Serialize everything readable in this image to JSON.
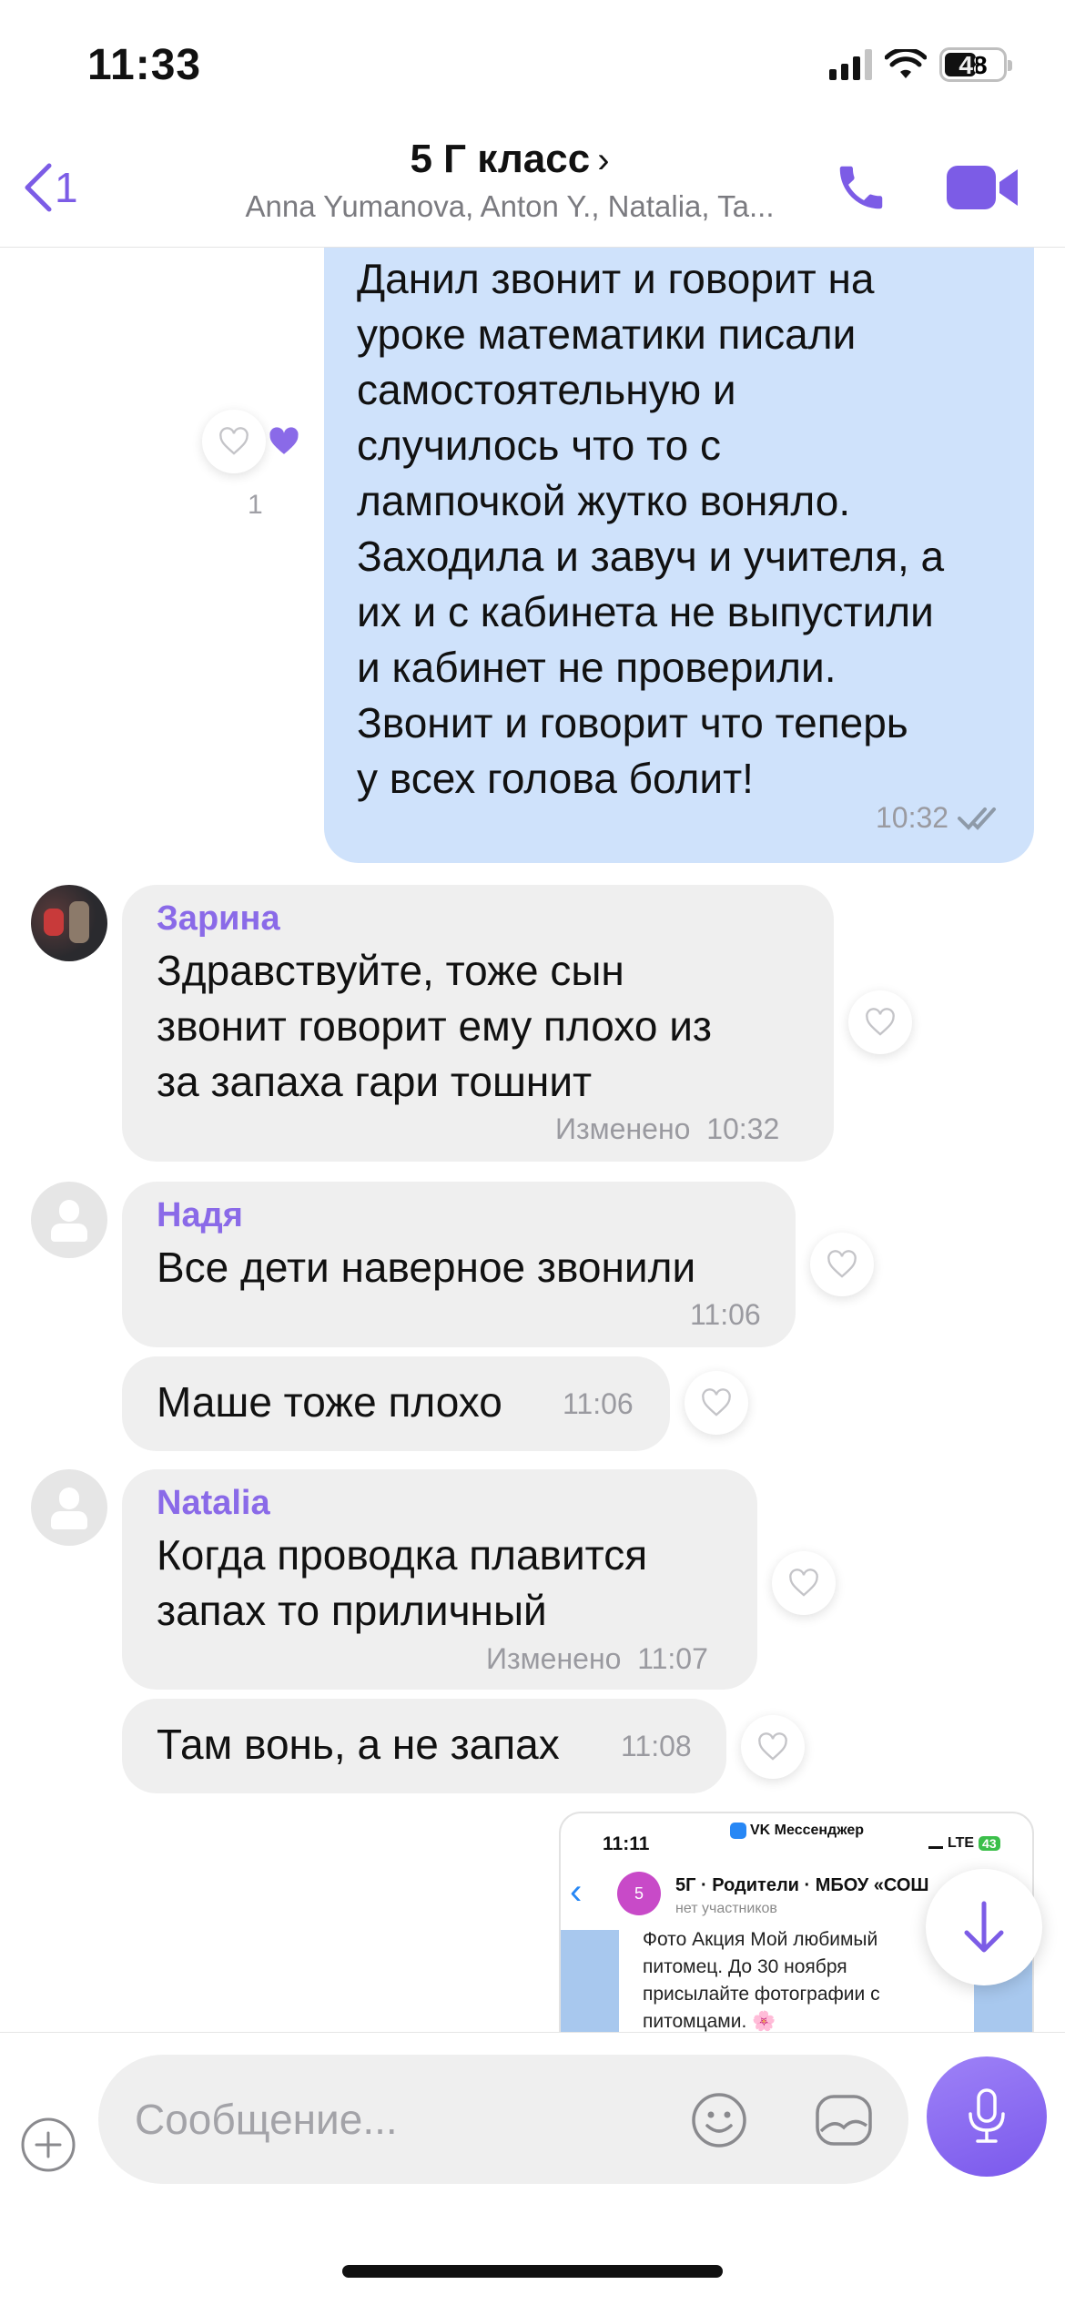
{
  "status_bar": {
    "time": "11:33",
    "battery": "48"
  },
  "header": {
    "back_count": "1",
    "title": "5 Г класс",
    "title_chevron": "›",
    "subtitle": "Anna Yumanova, Anton Y., Natalia, Ta..."
  },
  "messages": {
    "m1": {
      "text_lines": [
        "Данил звонит и говорит на",
        "уроке математики писали",
        "самостоятельную и",
        "случилось что то с",
        "лампочкой жутко воняло.",
        "Заходила и завуч и учителя, а",
        "их и с кабинета не выпустили",
        "и кабинет не проверили.",
        "Звонит  и говорит что теперь",
        "у всех голова болит!"
      ],
      "time": "10:32",
      "like_count": "1"
    },
    "m2": {
      "sender": "Зарина",
      "text_lines": [
        "Здравствуйте, тоже сын",
        "звонит говорит ему плохо из",
        "за запаха гари тошнит"
      ],
      "edited": "Изменено",
      "time": "10:32"
    },
    "m3": {
      "sender": "Надя",
      "text": "Все дети наверное звонили",
      "time": "11:06"
    },
    "m4": {
      "text": "Маше тоже плохо",
      "time": "11:06"
    },
    "m5": {
      "sender": "Natalia",
      "text_lines": [
        "Когда проводка плавится",
        "запах то приличный"
      ],
      "edited": "Изменено",
      "time": "11:07"
    },
    "m6": {
      "text": "Там вонь, а не запах",
      "time": "11:08"
    },
    "screenshot": {
      "time": "11:11",
      "app": "VK Мессенджер",
      "network": "LTE",
      "battery": "43",
      "chat_title": "5Г · Родители · МБОУ «СОШ",
      "chat_sub": "нет участников",
      "avatar_letter": "5",
      "lines": [
        "Фото Акция Мой любимый",
        "питомец. До 30 ноября",
        "присылайте фотографии с",
        "питомцами. 🌸"
      ]
    }
  },
  "input": {
    "placeholder": "Сообщение..."
  },
  "colors": {
    "accent": "#7c5ce6",
    "outgoing": "#cfe2fb",
    "incoming": "#efefef"
  }
}
